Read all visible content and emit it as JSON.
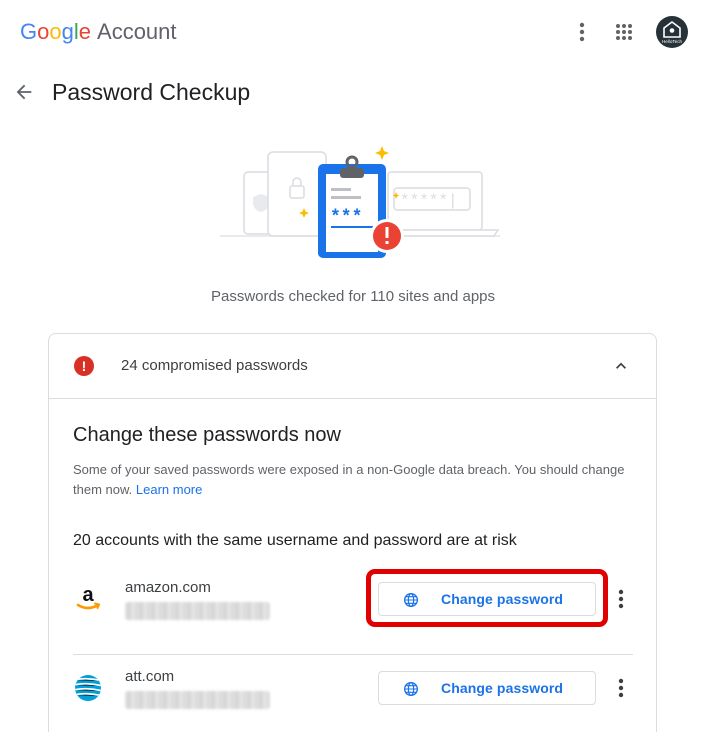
{
  "header": {
    "brand_letters": [
      "G",
      "o",
      "o",
      "g",
      "l",
      "e"
    ],
    "brand_suffix": "Account",
    "avatar_text": "HelloTech"
  },
  "page": {
    "title": "Password Checkup",
    "checked_summary": "Passwords checked for 110 sites and apps"
  },
  "illustration": {
    "clipboard_text": "***",
    "password_mask": "*****|"
  },
  "card": {
    "header_label": "24 compromised passwords",
    "section_title": "Change these passwords now",
    "description": "Some of your saved passwords were exposed in a non-Google data breach. You should change them now.",
    "learn_more": "Learn more",
    "risk_heading": "20 accounts with the same username and password are at risk",
    "accounts": [
      {
        "site": "amazon.com",
        "button_label": "Change password",
        "highlighted": true
      },
      {
        "site": "att.com",
        "button_label": "Change password",
        "highlighted": false
      }
    ]
  },
  "colors": {
    "google_blue": "#4285f4",
    "google_red": "#ea4335",
    "google_yellow": "#fbbc05",
    "google_green": "#34a853",
    "link_blue": "#1a73e8",
    "alert_red": "#d93025",
    "highlight_red": "#e00000"
  },
  "icons": [
    "more-vert-icon",
    "apps-grid-icon",
    "avatar",
    "back-arrow-icon",
    "alert-icon",
    "chevron-up-icon",
    "globe-icon",
    "amazon-logo",
    "att-logo"
  ]
}
